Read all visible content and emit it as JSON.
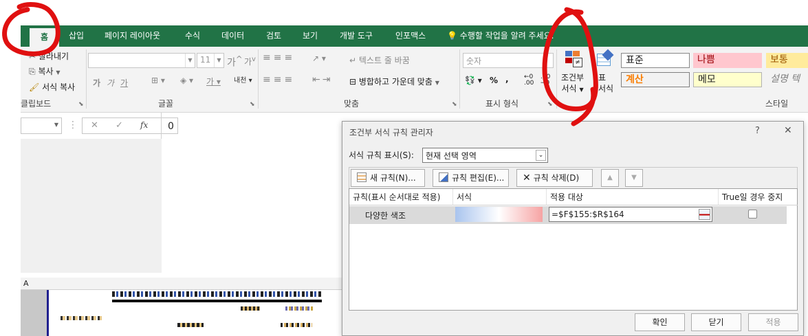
{
  "ribbon": {
    "tabs": [
      "홈",
      "삽입",
      "페이지 레이아웃",
      "수식",
      "데이터",
      "검토",
      "보기",
      "개발 도구",
      "인포맥스"
    ],
    "tell_me": "수행할 작업을 알려 주세요.",
    "clipboard": {
      "cut": "잘라내기",
      "copy": "복사",
      "format_painter": "서식 복사",
      "label": "클립보드"
    },
    "font": {
      "size": "11",
      "grow": "가",
      "shrink": "가",
      "bold": "가",
      "italic": "가",
      "underline": "가",
      "label": "글꼴"
    },
    "alignment": {
      "wrap_text": "텍스트 줄 바꿈",
      "merge_center": "병합하고 가운데 맞춤",
      "label": "맞춤"
    },
    "number": {
      "format": "숫자",
      "percent": "%",
      "comma": ",",
      "label": "표시 형식"
    },
    "conditional": {
      "line1": "조건부",
      "line2": "서식"
    },
    "table_format": {
      "line1": "표",
      "line2": "서식"
    },
    "styles": {
      "normal": "표준",
      "bad": "나쁨",
      "neutral": "보통",
      "calc": "계산",
      "note": "메모",
      "explanatory": "설명 텍스",
      "label": "스타일"
    },
    "colors": {
      "green": "#217346",
      "bad_bg": "#ffc7ce",
      "bad_fg": "#9c0006",
      "neutral_bg": "#ffeb9c",
      "neutral_fg": "#9c5700",
      "calc_fg": "#fa7d00",
      "note_bg": "#ffffcc"
    }
  },
  "formula_bar": {
    "cancel": "✕",
    "enter": "✓",
    "fx": "fx",
    "value": "0"
  },
  "sheet": {
    "col_a": "A"
  },
  "dialog": {
    "title": "조건부 서식 규칙 관리자",
    "help": "?",
    "close": "✕",
    "show_rules_label": "서식 규칙 표시(S):",
    "show_rules_value": "현재 선택 영역",
    "new_rule": "새 규칙(N)...",
    "edit_rule": "규칙 편집(E)...",
    "delete_rule": "규칙 삭제(D)",
    "columns": [
      "규칙(표시 순서대로 적용)",
      "서식",
      "적용 대상",
      "True일 경우 중지"
    ],
    "rule": {
      "name": "다양한 색조",
      "applies_to": "=$F$155:$R$164"
    },
    "ok": "확인",
    "close_btn": "닫기",
    "apply": "적용"
  }
}
